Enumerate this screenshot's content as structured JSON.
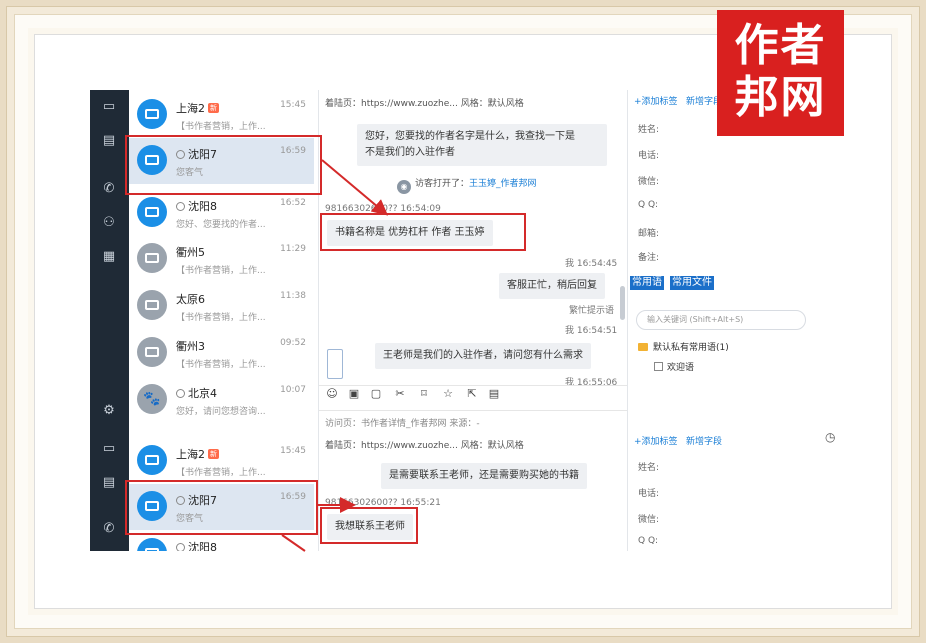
{
  "logo": {
    "line1": "作者",
    "line2": "邦网"
  },
  "rail": {
    "icons": [
      "monitor-icon",
      "id-card-icon",
      "phone-icon",
      "users-icon",
      "ticket-icon",
      "settings-icon",
      "monitor-icon",
      "id-card-icon",
      "phone-icon"
    ]
  },
  "list": {
    "items": [
      {
        "name": "上海2",
        "new": "新",
        "time": "15:45",
        "sub": "【书作者营销，上作...",
        "avatar": "blue"
      },
      {
        "name": "沈阳7",
        "time": "16:59",
        "sub": "您客气",
        "avatar": "blue",
        "selected": true,
        "chat": true
      },
      {
        "name": "沈阳8",
        "time": "16:52",
        "sub": "您好、您要找的作者...",
        "avatar": "blue",
        "chat": true
      },
      {
        "name": "衢州5",
        "time": "11:29",
        "sub": "【书作者营销，上作...",
        "avatar": "gray"
      },
      {
        "name": "太原6",
        "time": "11:38",
        "sub": "【书作者营销，上作...",
        "avatar": "gray"
      },
      {
        "name": "衢州3",
        "time": "09:52",
        "sub": "【书作者营销，上作...",
        "avatar": "gray"
      },
      {
        "name": "北京4",
        "time": "10:07",
        "sub": "您好，请问您想咨询...",
        "avatar": "gray",
        "chat": true
      },
      {
        "name": "上海2",
        "new": "新",
        "time": "15:45",
        "sub": "【书作者营销，上作...",
        "avatar": "blue"
      },
      {
        "name": "沈阳7",
        "time": "16:59",
        "sub": "您客气",
        "avatar": "blue",
        "selected": true,
        "chat": true
      },
      {
        "name": "沈阳8",
        "time": "",
        "sub": "",
        "avatar": "blue",
        "chat": true
      }
    ]
  },
  "chat": {
    "top_source": "着陆页：https://www.zuozhe...    风格：默认风格",
    "msg1": "您好，您要找的作者名字是什么，我查找一下是\n不是我们的入驻作者",
    "sys_open": "访客打开了：",
    "sys_link": "王玉婷_作者邦网",
    "meta1": "98166302600?? 16:54:09",
    "msg_book": "书籍名称是 优势杠杆   作者 王玉婷",
    "meta2": "我 16:54:45",
    "msg_busy": "客服正忙，稍后回复",
    "busy_note": "繁忙提示语",
    "meta3": "我 16:54:51",
    "msg_author": "王老师是我们的入驻作者，请问您有什么需求",
    "meta4": "我 16:55:06",
    "toolbar_icons": [
      "emoji-icon",
      "image-icon",
      "folder-icon",
      "scissors-icon",
      "bookmark-icon",
      "star-icon",
      "share-icon",
      "note-icon"
    ],
    "bottom_cut": "访问页：书作者详情_作者邦网     来源：-",
    "bottom_source": "着陆页：https://www.zuozhe...    风格：默认风格",
    "msg_contact": "是需要联系王老师，还是需要购买她的书籍",
    "meta5": "98166302600?? 16:55:21",
    "msg_want": "我想联系王老师"
  },
  "right": {
    "add_tag": "+添加标签",
    "add_field": "新增字段",
    "fields": [
      "姓名:",
      "电话:",
      "微信:",
      "Q Q:",
      "邮箱:",
      "备注:"
    ],
    "tab1": "常用语",
    "tab2": "常用文件",
    "search_placeholder": "输入关键词 (Shift+Alt+S)",
    "folder": "默认私有常用语(1)",
    "sub_item": "欢迎语",
    "fields2": [
      "姓名:",
      "电话:",
      "微信:",
      "Q Q:"
    ]
  }
}
